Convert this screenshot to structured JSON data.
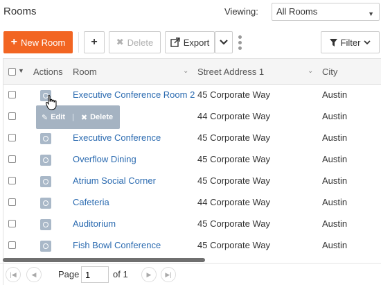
{
  "header": {
    "title": "Rooms",
    "viewing_label": "Viewing:",
    "view_select_value": "All Rooms"
  },
  "toolbar": {
    "new_room": "New Room",
    "delete": "Delete",
    "export": "Export",
    "filter": "Filter"
  },
  "grid": {
    "columns": {
      "actions": "Actions",
      "room": "Room",
      "street": "Street Address 1",
      "city": "City"
    },
    "rows": [
      {
        "room": "Executive Conference Room 2",
        "street": "45 Corporate Way",
        "city": "Austin"
      },
      {
        "room": "",
        "street": "44 Corporate Way",
        "city": "Austin"
      },
      {
        "room": "Executive Conference",
        "street": "45 Corporate Way",
        "city": "Austin"
      },
      {
        "room": "Overflow Dining",
        "street": "45 Corporate Way",
        "city": "Austin"
      },
      {
        "room": "Atrium Social Corner",
        "street": "45 Corporate Way",
        "city": "Austin"
      },
      {
        "room": "Cafeteria",
        "street": "44 Corporate Way",
        "city": "Austin"
      },
      {
        "room": "Auditorium",
        "street": "45 Corporate Way",
        "city": "Austin"
      },
      {
        "room": "Fish Bowl Conference",
        "street": "45 Corporate Way",
        "city": "Austin"
      }
    ]
  },
  "popover": {
    "edit": "Edit",
    "delete": "Delete"
  },
  "pager": {
    "page_label": "Page",
    "page_value": "1",
    "of_label": "of 1"
  },
  "colors": {
    "accent": "#f26522",
    "link": "#2a6ab0",
    "action_icon": "#a9b8c8"
  }
}
